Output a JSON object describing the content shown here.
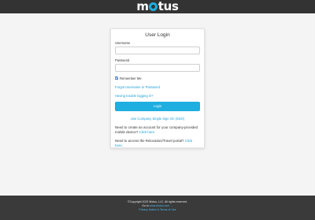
{
  "header": {
    "logo_text": "motus",
    "logo_pre": "m",
    "logo_post": "tus"
  },
  "login": {
    "title": "User Login",
    "username_label": "Username",
    "username_value": "",
    "password_label": "Password",
    "password_value": "",
    "remember_label": "Remember Me",
    "remember_checked": true,
    "forgot_link": "Forgot Username or Password",
    "trouble_link": "Having trouble logging in?",
    "login_button": "Login",
    "sso_link": "Use Company Single Sign On (SSO)",
    "create_account_text": "Need to create an account for your company-provided mobile device?",
    "create_account_link": "Click here.",
    "relocation_text": "Need to access the Relocation/Travel portal?",
    "relocation_link": "Click here."
  },
  "footer": {
    "copyright": "©Copyright 2022 Motus, LLC. All rights reserved.",
    "goto_prefix": "Go to",
    "goto_link": "www.motus.com →",
    "privacy_link": "Privacy Notice & Terms of Use"
  },
  "colors": {
    "accent": "#1eaee0",
    "topbar": "#333333",
    "footer": "#3a3a3a",
    "link": "#1e9fd6"
  }
}
